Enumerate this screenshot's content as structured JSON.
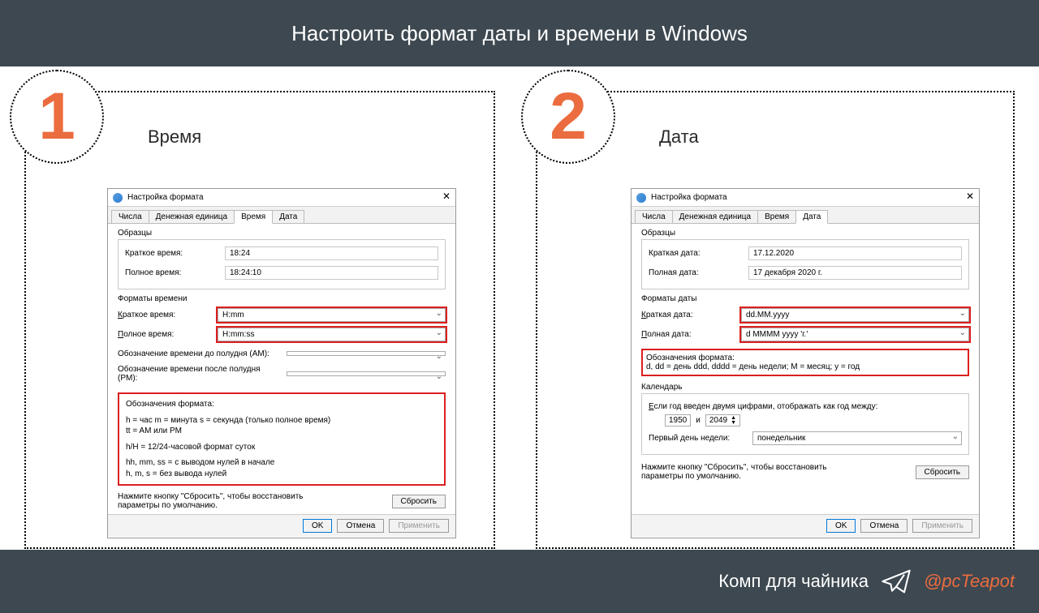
{
  "header": {
    "title": "Настроить формат даты и времени в Windows"
  },
  "badges": {
    "one": "1",
    "two": "2"
  },
  "panels": {
    "time": {
      "title": "Время"
    },
    "date": {
      "title": "Дата"
    }
  },
  "dialog": {
    "title": "Настройка формата",
    "tabs": {
      "numbers": "Числа",
      "currency": "Денежная единица",
      "time": "Время",
      "date": "Дата"
    },
    "samples_label": "Образцы",
    "time": {
      "short_label": "Краткое время:",
      "short_value": "18:24",
      "long_label": "Полное время:",
      "long_value": "18:24:10",
      "formats_label": "Форматы времени",
      "fmt_short_label": "Краткое время:",
      "fmt_short_val": "H:mm",
      "fmt_long_label": "Полное время:",
      "fmt_long_val": "H:mm:ss",
      "am_label": "Обозначение времени до полудня (AM):",
      "pm_label": "Обозначение времени после полудня (PM):",
      "legend_title": "Обозначения формата:",
      "legend_1": "h = час   m = минута   s = секунда (только полное время)",
      "legend_2": "tt = AM или PM",
      "legend_3": "h/H = 12/24-часовой формат суток",
      "legend_4": "hh, mm, ss = с выводом нулей в начале",
      "legend_5": "h, m, s = без вывода нулей"
    },
    "date": {
      "short_label": "Краткая дата:",
      "short_value": "17.12.2020",
      "long_label": "Полная дата:",
      "long_value": "17 декабря 2020 г.",
      "formats_label": "Форматы даты",
      "fmt_short_label": "Краткая дата:",
      "fmt_short_val": "dd.MM.yyyy",
      "fmt_long_label": "Полная дата:",
      "fmt_long_val": "d MMMM yyyy 'г.'",
      "legend_title": "Обозначения формата:",
      "legend_1": "d, dd = день  ddd, dddd = день недели; M = месяц; y = год",
      "calendar_label": "Календарь",
      "year_hint": "Если год введен двумя цифрами, отображать как год между:",
      "year_from": "1950",
      "year_between": "и",
      "year_to": "2049",
      "first_day_label": "Первый день недели:",
      "first_day_value": "понедельник"
    },
    "reset_hint": "Нажмите кнопку \"Сбросить\", чтобы восстановить параметры по умолчанию.",
    "reset_btn": "Сбросить",
    "ok": "OK",
    "cancel": "Отмена",
    "apply": "Применить"
  },
  "footer": {
    "text": "Комп для чайника",
    "handle": "@pcTeapot"
  }
}
